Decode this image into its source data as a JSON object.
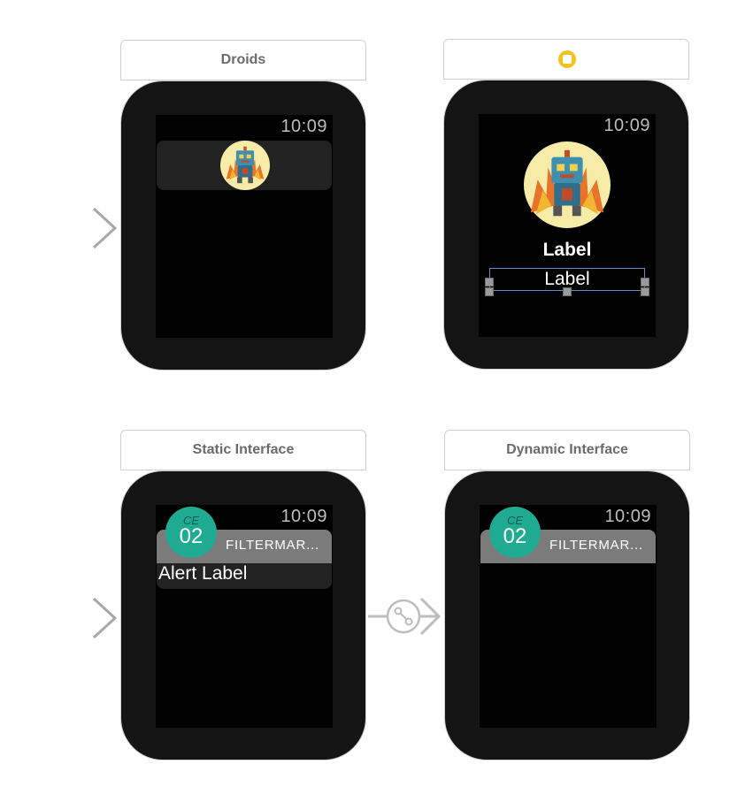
{
  "scenes": {
    "droids": {
      "title": "Droids",
      "time": "10:09"
    },
    "detail": {
      "time": "10:09",
      "label_title": "Label",
      "label_subtitle": "Label",
      "header_icon": "view-controller-icon"
    },
    "static_interface": {
      "title": "Static Interface",
      "time": "10:09",
      "badge_top": "CE",
      "badge_number": "02",
      "sash_title": "FILTERMAR...",
      "alert_label": "Alert Label"
    },
    "dynamic_interface": {
      "title": "Dynamic Interface",
      "time": "10:09",
      "badge_top": "CE",
      "badge_number": "02",
      "sash_title": "FILTERMAR..."
    }
  },
  "colors": {
    "watch_body": "#141414",
    "badge": "#1faa92",
    "selection": "#5b8fc7",
    "header_icon": "#f3c21b"
  }
}
